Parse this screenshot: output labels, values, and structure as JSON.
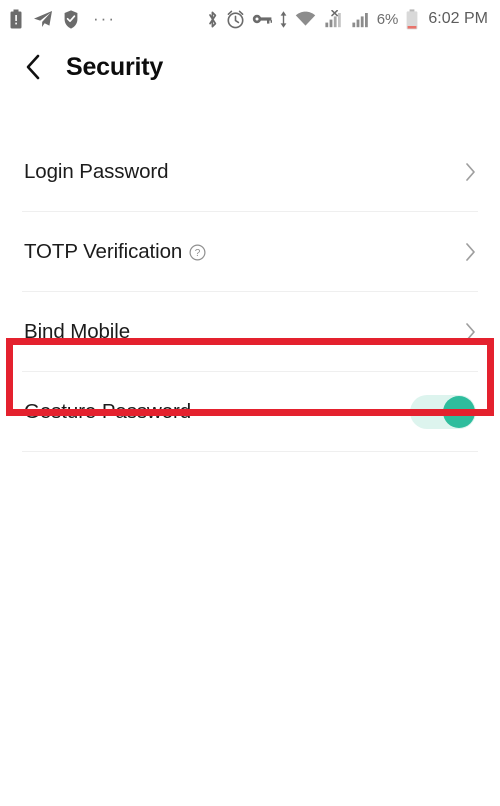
{
  "status_bar": {
    "left_icons": [
      {
        "name": "battery-alert-icon",
        "label": "battery alert"
      },
      {
        "name": "telegram-icon",
        "label": "telegram"
      },
      {
        "name": "shield-check-icon",
        "label": "shield check"
      }
    ],
    "overflow": "···",
    "right_icons": [
      {
        "name": "bluetooth-icon",
        "label": "bluetooth"
      },
      {
        "name": "alarm-clock-icon",
        "label": "alarm"
      },
      {
        "name": "vpn-key-icon",
        "label": "vpn"
      },
      {
        "name": "data-transfer-icon",
        "label": "data transfer"
      },
      {
        "name": "wifi-icon",
        "label": "wifi"
      },
      {
        "name": "signal-no-sim-icon",
        "label": "no sim signal"
      },
      {
        "name": "signal-bars-icon",
        "label": "cellular signal"
      }
    ],
    "battery_percent": "6%",
    "time": "6:02 PM"
  },
  "header": {
    "back_label": "‹",
    "title": "Security"
  },
  "list": {
    "rows": [
      {
        "id": "login-password",
        "label": "Login Password",
        "type": "chevron",
        "has_help": false,
        "highlighted": false
      },
      {
        "id": "totp-verification",
        "label": "TOTP Verification",
        "type": "chevron",
        "has_help": true,
        "help_glyph": "?",
        "highlighted": true
      },
      {
        "id": "bind-mobile",
        "label": "Bind Mobile",
        "type": "chevron",
        "has_help": false,
        "highlighted": false
      },
      {
        "id": "gesture-password",
        "label": "Gesture Password",
        "type": "toggle",
        "toggle_on": true,
        "has_help": false,
        "highlighted": false
      }
    ]
  },
  "colors": {
    "annotation_red": "#e4212e",
    "toggle_track_on": "#ddf4ee",
    "toggle_thumb_on": "#2ebd9d",
    "text_primary": "#1c1c1c",
    "chevron_grey": "#9e9e9e",
    "divider": "#efefef"
  }
}
